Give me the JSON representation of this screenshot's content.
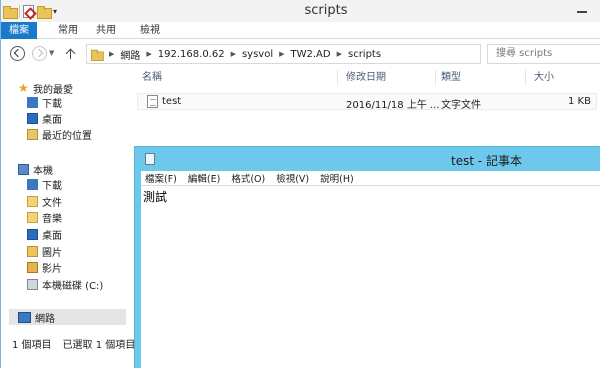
{
  "explorer": {
    "title": "scripts",
    "ribbon_tabs": [
      "檔案",
      "常用",
      "共用",
      "檢視"
    ],
    "address": {
      "crumbs": [
        "網路",
        "192.168.0.62",
        "sysvol",
        "TW2.AD",
        "scripts"
      ]
    },
    "search": {
      "placeholder": "搜尋 scripts"
    },
    "columns": [
      "名稱",
      "修改日期",
      "類型",
      "大小"
    ],
    "files": [
      {
        "name": "test",
        "modified": "2016/11/18 上午 ...",
        "type": "文字文件",
        "size": "1 KB"
      }
    ],
    "nav": {
      "favorites": {
        "label": "我的最愛",
        "items": [
          "下載",
          "桌面",
          "最近的位置"
        ]
      },
      "this_pc": {
        "label": "本機",
        "items": [
          "下載",
          "文件",
          "音樂",
          "桌面",
          "圖片",
          "影片",
          "本機磁碟 (C:)"
        ]
      },
      "network": {
        "label": "網路"
      }
    },
    "status": {
      "item_count": "1 個項目",
      "selected": "已選取 1 個項目"
    },
    "accent_color": "#1979ca"
  },
  "notepad": {
    "title": "test - 記事本",
    "menu": [
      "檔案(F)",
      "編輯(E)",
      "格式(O)",
      "檢視(V)",
      "說明(H)"
    ],
    "content": "測試",
    "frame_color": "#6ec8ec"
  }
}
